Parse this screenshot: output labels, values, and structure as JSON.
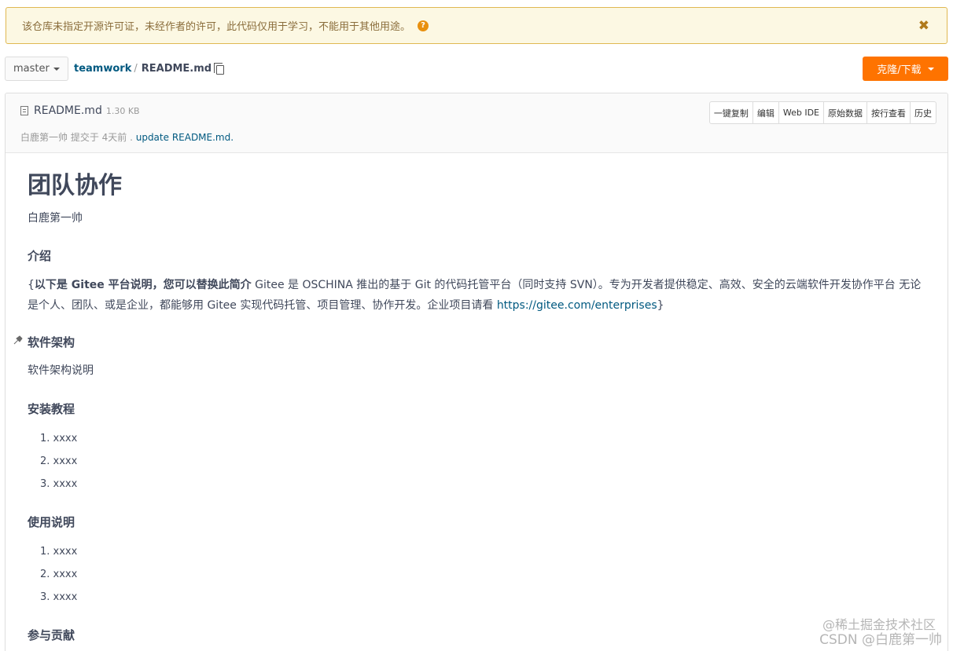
{
  "alert": {
    "message": "该仓库未指定开源许可证，未经作者的许可，此代码仅用于学习，不能用于其他用途。",
    "help_glyph": "?",
    "close_glyph": "✖"
  },
  "toolbar": {
    "branch": "master",
    "repo": "teamwork",
    "separator": "/",
    "file": "README.md",
    "clone_label": "克隆/下载"
  },
  "file": {
    "name": "README.md",
    "size": "1.30 KB",
    "commit_text": "白鹿第一帅 提交于 4天前 . ",
    "commit_message": "update README.md.",
    "actions": [
      "一键复制",
      "编辑",
      "Web IDE",
      "原始数据",
      "按行查看",
      "历史"
    ]
  },
  "readme": {
    "title": "团队协作",
    "author": "白鹿第一帅",
    "intro_heading": "介绍",
    "intro_open": "{",
    "intro_bold": "以下是 Gitee 平台说明，您可以替换此简介",
    "intro_text": " Gitee 是 OSCHINA 推出的基于 Git 的代码托管平台（同时支持 SVN）。专为开发者提供稳定、高效、安全的云端软件开发协作平台 无论是个人、团队、或是企业，都能够用 Gitee 实现代码托管、项目管理、协作开发。企业项目请看 ",
    "intro_link": "https://gitee.com/enterprises",
    "intro_close": "}",
    "arch_heading": "软件架构",
    "arch_text": "软件架构说明",
    "install_heading": "安装教程",
    "install_items": [
      "1. xxxx",
      "2. xxxx",
      "3. xxxx"
    ],
    "usage_heading": "使用说明",
    "usage_items": [
      "1. xxxx",
      "2. xxxx",
      "3. xxxx"
    ],
    "contrib_heading": "参与贡献"
  },
  "watermark": {
    "line1": "@稀土掘金技术社区",
    "line2": "CSDN @白鹿第一帅"
  },
  "colors": {
    "accent": "#fe7300",
    "link": "#005980",
    "alert_bg": "#fcf8e3"
  }
}
